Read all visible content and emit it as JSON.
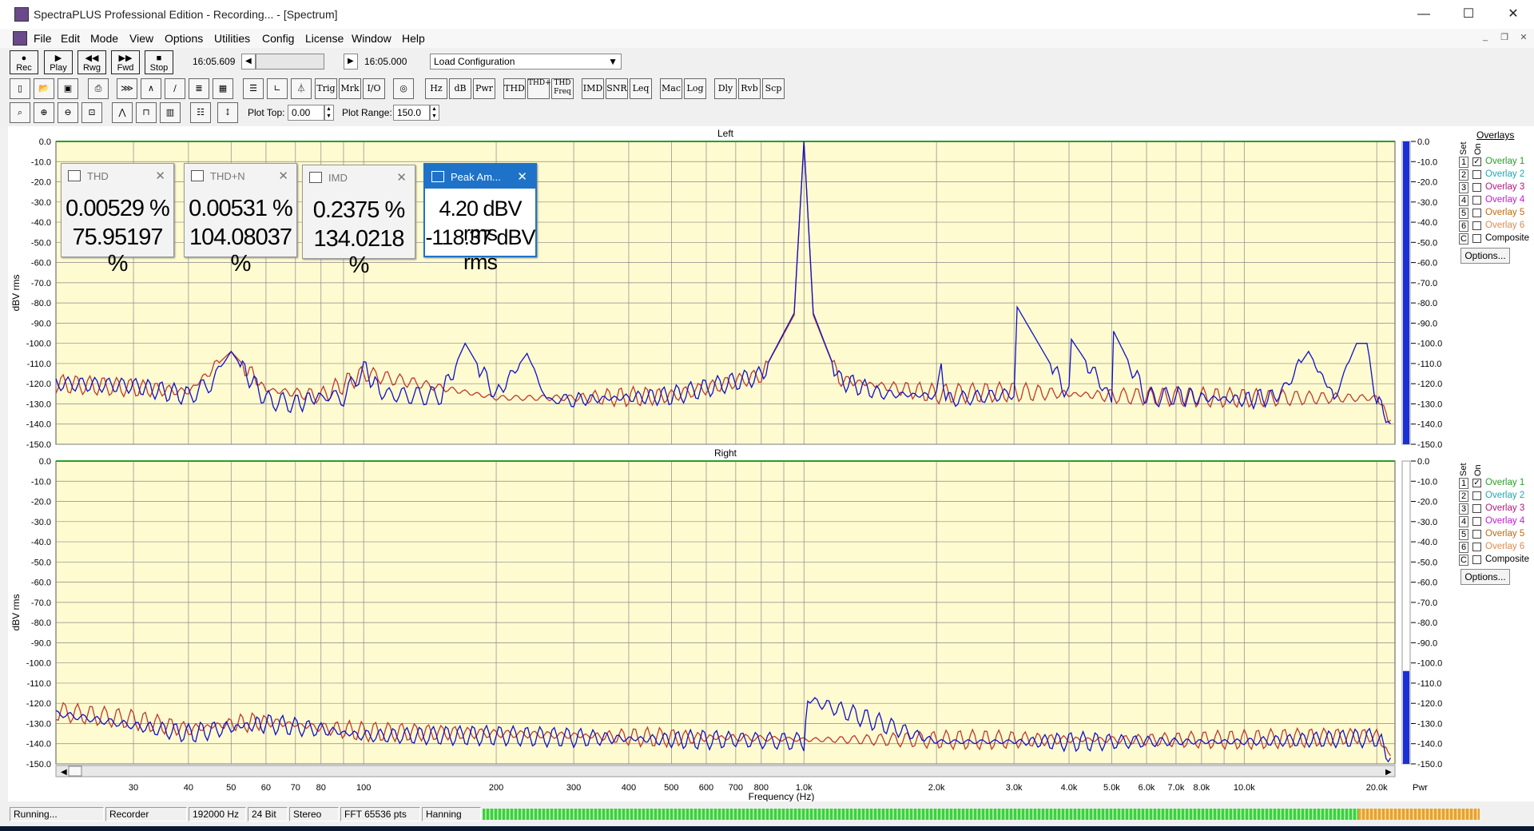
{
  "window": {
    "title": "SpectraPLUS Professional Edition - Recording... - [Spectrum]",
    "minimize": "—",
    "maximize": "☐",
    "close": "✕"
  },
  "menu": [
    "File",
    "Edit",
    "Mode",
    "View",
    "Options",
    "Utilities",
    "Config",
    "License",
    "Window",
    "Help"
  ],
  "transport": {
    "buttons": [
      "Rec",
      "Play",
      "Rwg",
      "Fwd",
      "Stop"
    ],
    "time_start": "16:05.609",
    "time_end": "16:05.000",
    "config_select": "Load Configuration"
  },
  "toolbar2": [
    "Trig",
    "Mrk",
    "I/O",
    "Hz",
    "dB",
    "Pwr",
    "THD",
    "THD+N",
    "THD Freq",
    "IMD",
    "SNR",
    "Leq",
    "Mac",
    "Log",
    "Dly",
    "Rvb",
    "Scp"
  ],
  "toolbar3": {
    "plot_top_label": "Plot Top:",
    "plot_top_value": "0.00",
    "plot_range_label": "Plot Range:",
    "plot_range_value": "150.0"
  },
  "meters": [
    {
      "title": "THD",
      "value1": "0.00529 %",
      "value2": "75.95197 %"
    },
    {
      "title": "THD+N",
      "value1": "0.00531 %",
      "value2": "104.08037 %"
    },
    {
      "title": "IMD",
      "value1": "0.2375 %",
      "value2": "134.0218 %"
    },
    {
      "title": "Peak Am...",
      "value1": "4.20 dBV rms",
      "value2": "-118.37 dBV rms"
    }
  ],
  "panels": {
    "left_title": "Left",
    "right_title": "Right",
    "ylabel": "dBV rms",
    "xlabel": "Frequency (Hz)",
    "pwr_label": "Pwr"
  },
  "overlays": {
    "header": "Overlays",
    "set_label": "Set",
    "on_label": "On",
    "items": [
      {
        "num": "1",
        "name": "Overlay 1",
        "checked": true,
        "color": "#2a9d2a"
      },
      {
        "num": "2",
        "name": "Overlay 2",
        "checked": false,
        "color": "#1fa7b3"
      },
      {
        "num": "3",
        "name": "Overlay 3",
        "checked": false,
        "color": "#b0197e"
      },
      {
        "num": "4",
        "name": "Overlay 4",
        "checked": false,
        "color": "#c21ccf"
      },
      {
        "num": "5",
        "name": "Overlay 5",
        "checked": false,
        "color": "#c06a12"
      },
      {
        "num": "6",
        "name": "Overlay 6",
        "checked": false,
        "color": "#e08a50"
      },
      {
        "num": "C",
        "name": "Composite",
        "checked": false,
        "color": "#000000"
      }
    ],
    "options_label": "Options..."
  },
  "status": {
    "state": "Running...",
    "mode": "Recorder",
    "rate": "192000 Hz",
    "bits": "24 Bit",
    "channels": "Stereo",
    "fft": "FFT 65536 pts",
    "window": "Hanning"
  },
  "colors": {
    "trace_blue": "#1010c8",
    "trace_red": "#c0392b",
    "plot_bg": "#fffbd0",
    "grid": "#888888",
    "meter_blue": "#1a2fd6"
  },
  "chart_data": [
    {
      "type": "line",
      "title": "Left",
      "xlabel": "Frequency (Hz)",
      "ylabel": "dBV rms",
      "xscale": "log",
      "xlim": [
        20,
        22000
      ],
      "ylim": [
        -150,
        0
      ],
      "x_ticks": [
        "30",
        "40",
        "50",
        "60",
        "70",
        "80",
        "100",
        "200",
        "300",
        "400",
        "500",
        "600",
        "700",
        "800",
        "1.0k",
        "2.0k",
        "3.0k",
        "4.0k",
        "5.0k",
        "6.0k",
        "7.0k",
        "8.0k",
        "10.0k",
        "20.0k"
      ],
      "y_ticks": [
        "0.0",
        "-10.0",
        "-20.0",
        "-30.0",
        "-40.0",
        "-50.0",
        "-60.0",
        "-70.0",
        "-80.0",
        "-90.0",
        "-100.0",
        "-110.0",
        "-120.0",
        "-130.0",
        "-140.0",
        "-150.0"
      ],
      "series": [
        {
          "x": [
            20,
            30,
            40,
            45,
            50,
            55,
            60,
            70,
            80,
            90,
            100,
            110,
            130,
            150,
            170,
            200,
            235,
            260,
            300,
            500,
            800,
            950,
            1000,
            1050,
            1200,
            1500,
            2000,
            2050,
            2100,
            3000,
            3050,
            4000,
            4050,
            5000,
            5050,
            6000,
            7000,
            8000,
            10000,
            12000,
            14000,
            16000,
            18000,
            19000,
            20000,
            21500
          ],
          "y": [
            -120,
            -121,
            -126,
            -120,
            -104,
            -117,
            -128,
            -130,
            -126,
            -127,
            -112,
            -125,
            -126,
            -126,
            -100,
            -126,
            -105,
            -128,
            -128,
            -126,
            -116,
            -85,
            0,
            -85,
            -118,
            -125,
            -126,
            -110,
            -128,
            -125,
            -82,
            -126,
            -98,
            -128,
            -94,
            -127,
            -126,
            -127,
            -128,
            -126,
            -104,
            -127,
            -100,
            -100,
            -128,
            -140
          ]
        },
        {
          "x": [
            20,
            30,
            40,
            50,
            60,
            80,
            100,
            200,
            300,
            500,
            800,
            950,
            1000,
            1050,
            1200,
            2000,
            3000,
            5000,
            10000,
            20000,
            21500
          ],
          "y": [
            -120,
            -122,
            -124,
            -104,
            -123,
            -126,
            -115,
            -127,
            -127,
            -126,
            -116,
            -86,
            0,
            -86,
            -118,
            -125,
            -124,
            -126,
            -127,
            -127,
            -138
          ]
        }
      ]
    },
    {
      "type": "line",
      "title": "Right",
      "xlabel": "Frequency (Hz)",
      "ylabel": "dBV rms",
      "xscale": "log",
      "xlim": [
        20,
        22000
      ],
      "ylim": [
        -150,
        0
      ],
      "series": [
        {
          "x": [
            20,
            30,
            40,
            50,
            60,
            80,
            100,
            200,
            300,
            500,
            700,
            1000,
            1020,
            2000,
            3000,
            5000,
            10000,
            20000,
            21500
          ],
          "y": [
            -125,
            -131,
            -135,
            -132,
            -130,
            -133,
            -136,
            -136,
            -137,
            -138,
            -138,
            -139,
            -118,
            -139,
            -139,
            -139,
            -139,
            -137,
            -147
          ]
        },
        {
          "x": [
            20,
            30,
            40,
            50,
            60,
            80,
            100,
            200,
            300,
            500,
            700,
            1000,
            2000,
            5000,
            10000,
            20000,
            21500
          ],
          "y": [
            -124,
            -128,
            -133,
            -130,
            -129,
            -132,
            -134,
            -135,
            -136,
            -137,
            -137,
            -138,
            -138,
            -138,
            -138,
            -136,
            -146
          ]
        }
      ]
    }
  ]
}
